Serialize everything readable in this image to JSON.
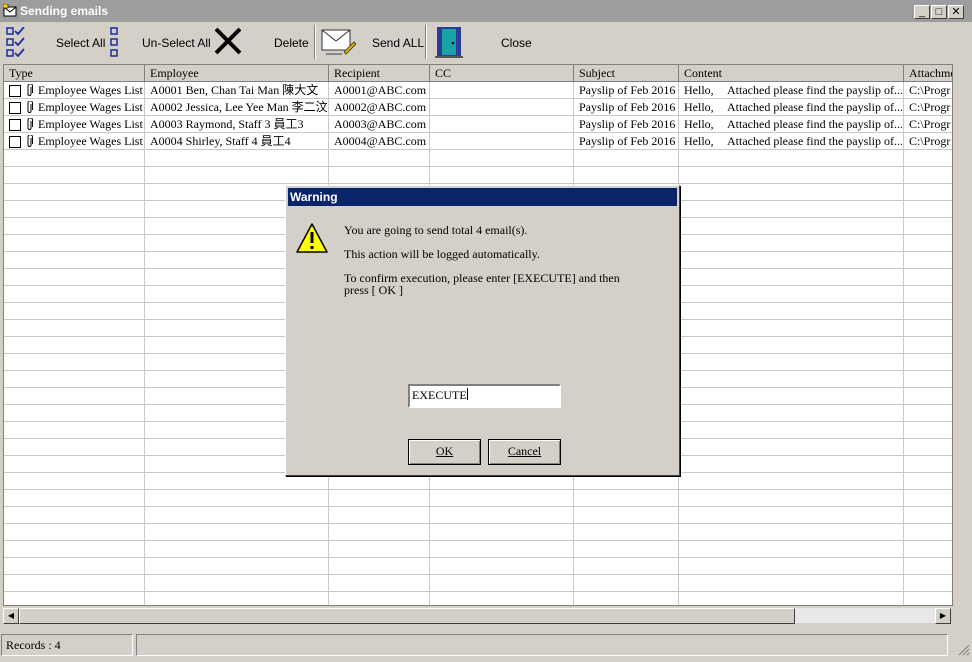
{
  "window": {
    "title": "Sending emails"
  },
  "toolbar": {
    "select_all": "Select All",
    "unselect_all": "Un-Select All",
    "delete": "Delete",
    "send_all": "Send ALL",
    "close": "Close"
  },
  "grid": {
    "columns": [
      "Type",
      "Employee",
      "Recipient",
      "CC",
      "Subject",
      "Content",
      "Attachme"
    ],
    "rows": [
      {
        "type": "Employee Wages List",
        "employee": "A0001 Ben, Chan Tai Man 陳大文",
        "recipient": "A0001@ABC.com",
        "cc": "",
        "subject": "Payslip of Feb 2016",
        "content_greeting": "Hello,",
        "content": "Attached please find the payslip of...",
        "attachment": "C:\\Progr"
      },
      {
        "type": "Employee Wages List",
        "employee": "A0002 Jessica, Lee Yee Man 李二汶",
        "recipient": "A0002@ABC.com",
        "cc": "",
        "subject": "Payslip of Feb 2016",
        "content_greeting": "Hello,",
        "content": "Attached please find the payslip of...",
        "attachment": "C:\\Progr"
      },
      {
        "type": "Employee Wages List",
        "employee": "A0003 Raymond, Staff 3 員工3",
        "recipient": "A0003@ABC.com",
        "cc": "",
        "subject": "Payslip of Feb 2016",
        "content_greeting": "Hello,",
        "content": "Attached please find the payslip of...",
        "attachment": "C:\\Progr"
      },
      {
        "type": "Employee Wages List",
        "employee": "A0004 Shirley, Staff 4 員工4",
        "recipient": "A0004@ABC.com",
        "cc": "",
        "subject": "Payslip of Feb 2016",
        "content_greeting": "Hello,",
        "content": "Attached please find the payslip of...",
        "attachment": "C:\\Progr"
      }
    ]
  },
  "status": {
    "records": "Records : 4"
  },
  "dialog": {
    "title": "Warning",
    "line1": "You are going to send total  4  email(s).",
    "line2": "This action will be logged automatically.",
    "line3": "To confirm execution, please enter  [EXECUTE] and then",
    "line4": "press [ OK ]",
    "input_value": "EXECUTE",
    "ok": "OK",
    "cancel": "Cancel"
  },
  "icons": {
    "app": "mail-window-icon",
    "select_all": "checklist-icon",
    "unselect_all": "empty-checklist-icon",
    "delete": "x-delete-icon",
    "send_all": "envelope-send-icon",
    "close": "door-exit-icon",
    "warning": "warning-triangle-icon",
    "attachment": "paperclip-icon"
  },
  "colors": {
    "dialog_title_bg": "#0a246a",
    "window_title_bg": "#9d9d9d",
    "face": "#d4d0c8",
    "warning_yellow": "#ffff00"
  }
}
